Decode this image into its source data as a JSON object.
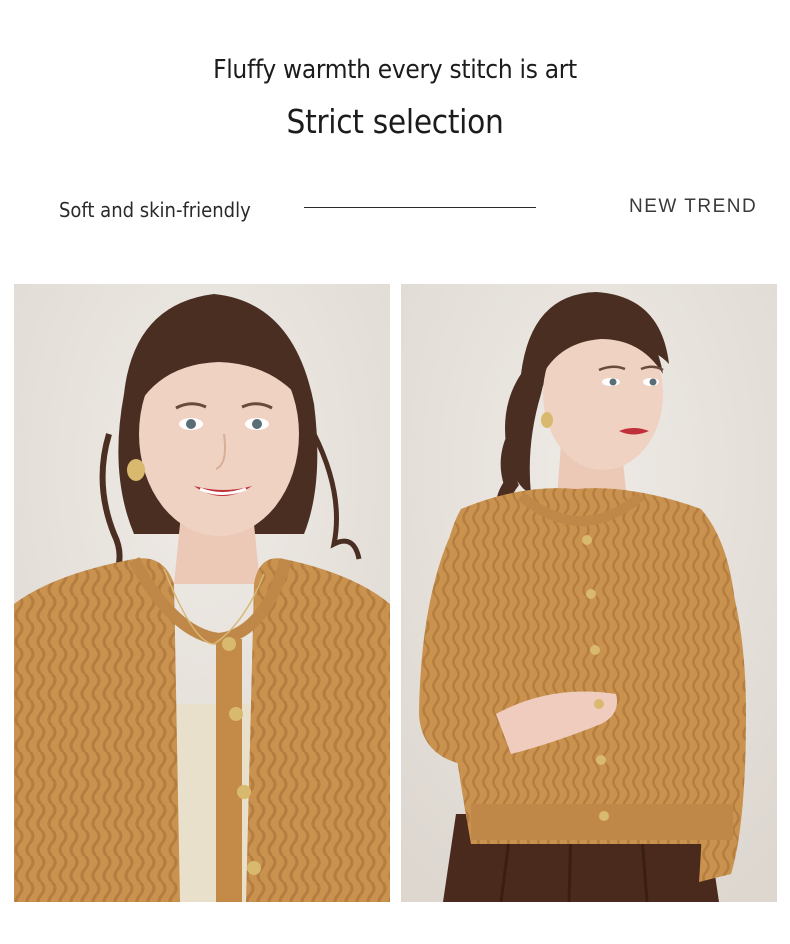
{
  "header": {
    "headline": "Fluffy warmth every stitch is art",
    "subheadline": "Strict selection"
  },
  "taglines": {
    "left": "Soft and skin-friendly",
    "right": "NEW TREND"
  },
  "colors": {
    "background": "#ffffff",
    "photo_wall": "#e7e2dc",
    "sweater_camel": "#c9924f",
    "hair_brown": "#4a2e22",
    "skin": "#f0d2c2",
    "skirt_brown": "#4b2a1e",
    "camisole_cream": "#e9e0cc",
    "buttons_gold": "#d9b96e"
  },
  "photos": [
    {
      "subject": "model-smiling-front",
      "icon": "photo-icon"
    },
    {
      "subject": "model-side-pose",
      "icon": "photo-icon"
    }
  ]
}
